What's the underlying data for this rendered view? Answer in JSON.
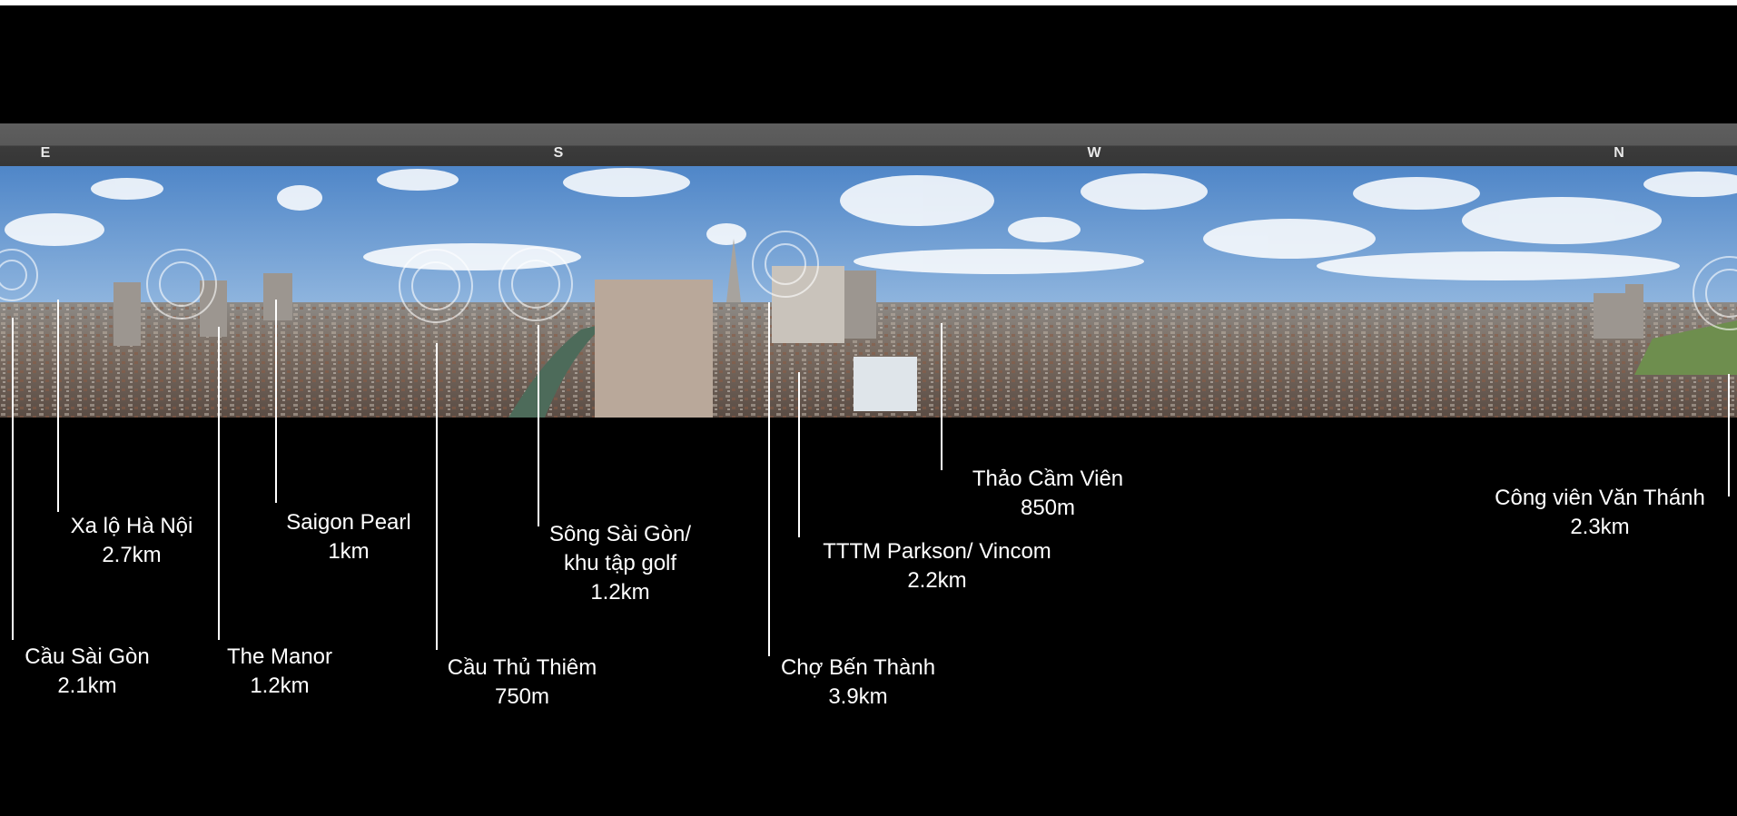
{
  "compass": {
    "east": "E",
    "south": "S",
    "west": "W",
    "north": "N"
  },
  "colors": {
    "background": "#000000",
    "label_text": "#ffffff",
    "compass_bar": "#4a4a4a",
    "sky": "#5f93cf"
  },
  "landmarks": [
    {
      "name": "Cầu Sài Gòn",
      "distance": "2.1km"
    },
    {
      "name": "Xa lộ Hà Nội",
      "distance": "2.7km"
    },
    {
      "name": "The Manor",
      "distance": "1.2km"
    },
    {
      "name": "Saigon Pearl",
      "distance": "1km"
    },
    {
      "name": "Cầu Thủ Thiêm",
      "distance": "750m"
    },
    {
      "name": "Sông Sài Gòn/",
      "name_line2": "khu tập golf",
      "distance": "1.2km"
    },
    {
      "name": "Chợ Bến Thành",
      "distance": "3.9km"
    },
    {
      "name": "TTTM Parkson/ Vincom",
      "distance": "2.2km"
    },
    {
      "name": "Thảo Cầm Viên",
      "distance": "850m"
    },
    {
      "name": "Công viên Văn Thánh",
      "distance": "2.3km"
    }
  ]
}
